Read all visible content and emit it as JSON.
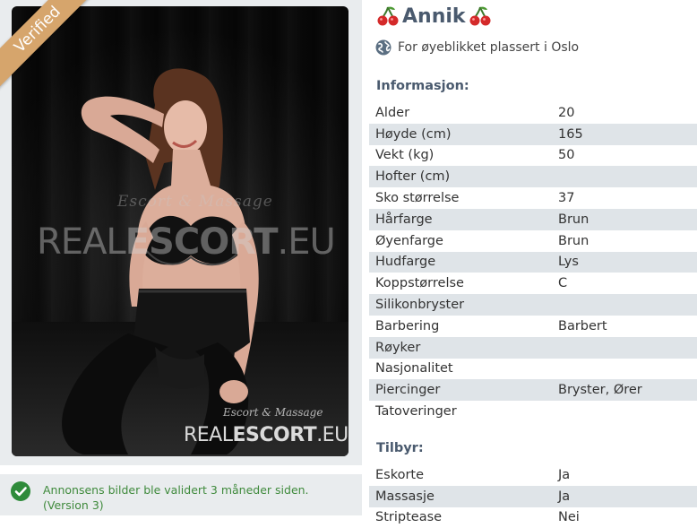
{
  "photo": {
    "badge": "Verified",
    "watermark_script": "Escort & Massage",
    "watermark_main_light": "REAL",
    "watermark_main_bold": "ESCORT",
    "watermark_main_suffix": ".EU"
  },
  "validation": {
    "icon": "check-circle-icon",
    "line1": "Annonsens bilder ble validert 3 måneder siden.",
    "line2": "(Version 3)"
  },
  "profile": {
    "name": "Annik",
    "name_icon": "cherry-icon",
    "location_icon": "globe-icon",
    "location": "For øyeblikket plassert i Oslo"
  },
  "info": {
    "title": "Informasjon:",
    "rows": [
      {
        "key": "Alder",
        "value": "20"
      },
      {
        "key": "Høyde (cm)",
        "value": "165"
      },
      {
        "key": "Vekt (kg)",
        "value": "50"
      },
      {
        "key": "Hofter (cm)",
        "value": ""
      },
      {
        "key": "Sko størrelse",
        "value": "37"
      },
      {
        "key": "Hårfarge",
        "value": "Brun"
      },
      {
        "key": "Øyenfarge",
        "value": "Brun"
      },
      {
        "key": "Hudfarge",
        "value": "Lys"
      },
      {
        "key": "Koppstørrelse",
        "value": "C"
      },
      {
        "key": "Silikonbryster",
        "value": ""
      },
      {
        "key": "Barbering",
        "value": "Barbert"
      },
      {
        "key": "Røyker",
        "value": ""
      },
      {
        "key": "Nasjonalitet",
        "value": ""
      },
      {
        "key": "Piercinger",
        "value": "Bryster, Ører"
      },
      {
        "key": "Tatoveringer",
        "value": ""
      }
    ]
  },
  "offers": {
    "title": "Tilbyr:",
    "rows": [
      {
        "key": "Eskorte",
        "value": "Ja"
      },
      {
        "key": "Massasje",
        "value": "Ja"
      },
      {
        "key": "Striptease",
        "value": "Nei"
      }
    ]
  },
  "colors": {
    "ribbon": "#d6a56c",
    "heading": "#4a5a6e",
    "row_alt": "#dfe4e8",
    "notice_text": "#3f8a3c",
    "check": "#2e8b3a"
  }
}
